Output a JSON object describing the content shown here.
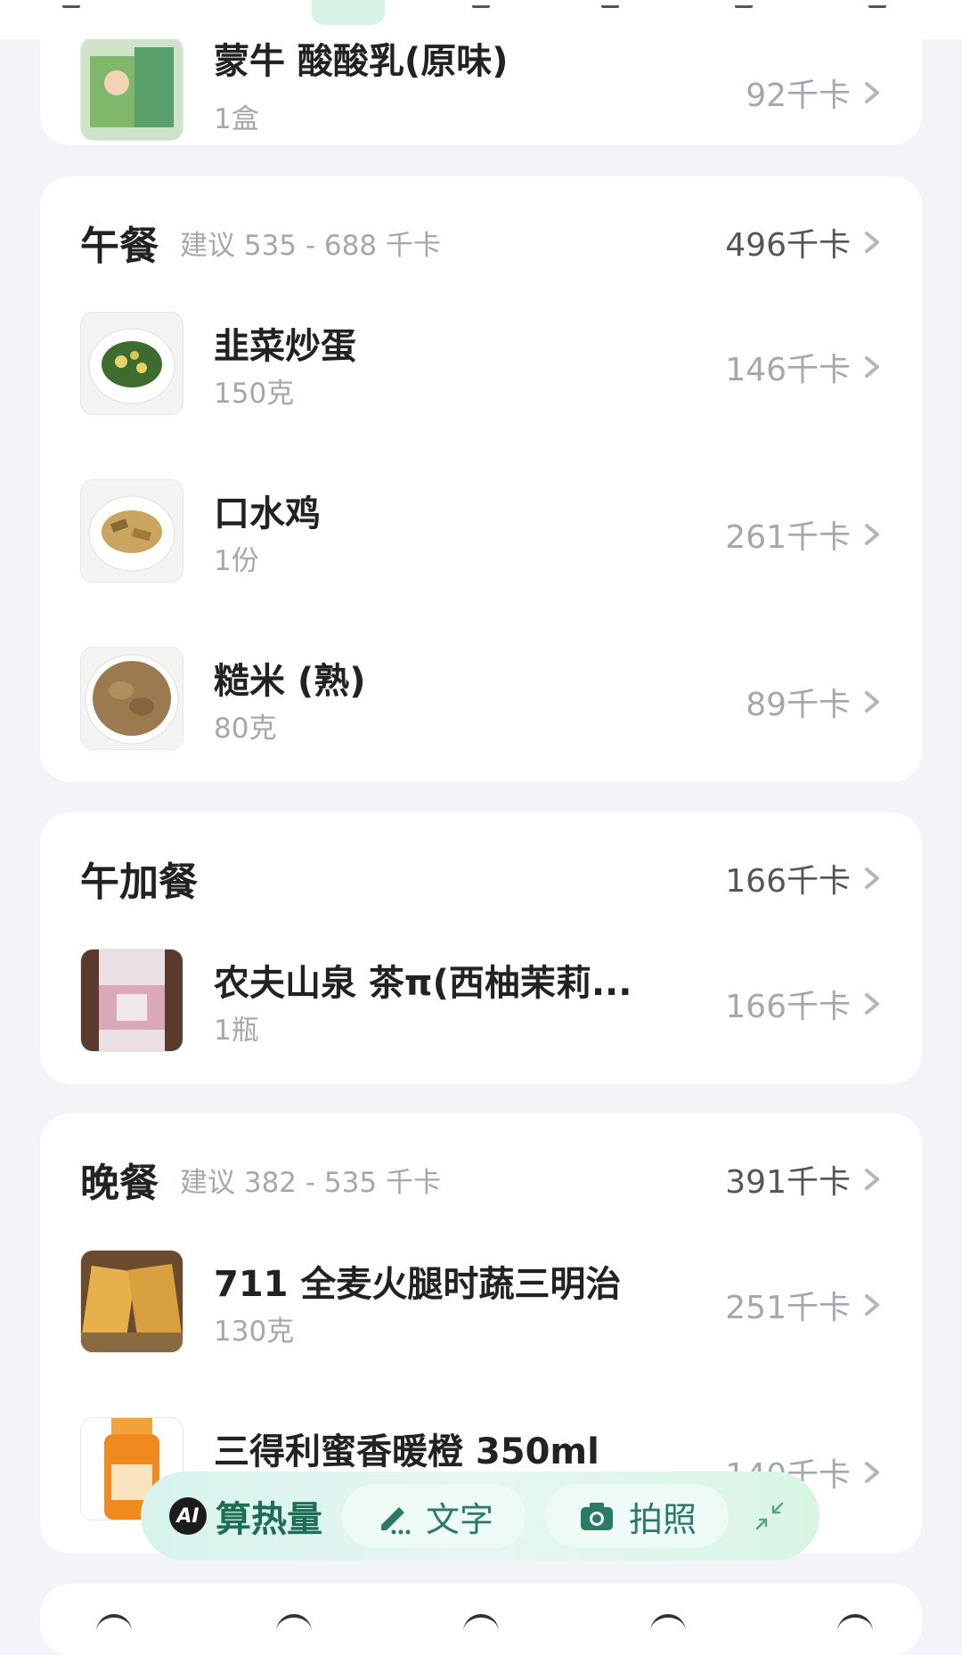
{
  "breakfast_tail": {
    "item": {
      "name": "蒙牛 酸酸乳(原味)",
      "qty": "1盒",
      "kcal": "92千卡"
    }
  },
  "meals": [
    {
      "title": "午餐",
      "suggest": "建议 535 - 688 千卡",
      "total": "496千卡",
      "items": [
        {
          "name": "韭菜炒蛋",
          "qty": "150克",
          "kcal": "146千卡"
        },
        {
          "name": "口水鸡",
          "qty": "1份",
          "kcal": "261千卡"
        },
        {
          "name": "糙米 (熟)",
          "qty": "80克",
          "kcal": "89千卡"
        }
      ]
    },
    {
      "title": "午加餐",
      "suggest": "",
      "total": "166千卡",
      "items": [
        {
          "name": "农夫山泉 茶π(西柚茉莉...",
          "qty": "1瓶",
          "kcal": "166千卡"
        }
      ]
    },
    {
      "title": "晚餐",
      "suggest": "建议 382 - 535 千卡",
      "total": "391千卡",
      "items": [
        {
          "name": "711 全麦火腿时蔬三明治",
          "qty": "130克",
          "kcal": "251千卡"
        },
        {
          "name": "三得利蜜香暖橙 350ml",
          "qty": "",
          "kcal": "140千卡"
        }
      ]
    }
  ],
  "fab": {
    "ai_badge": "AI",
    "ai_label": "算热量",
    "text_label": "文字",
    "photo_label": "拍照"
  },
  "colors": {
    "accent": "#1d6e55",
    "selected_tab": "#d8f3e4",
    "background": "#f3f4f8"
  }
}
